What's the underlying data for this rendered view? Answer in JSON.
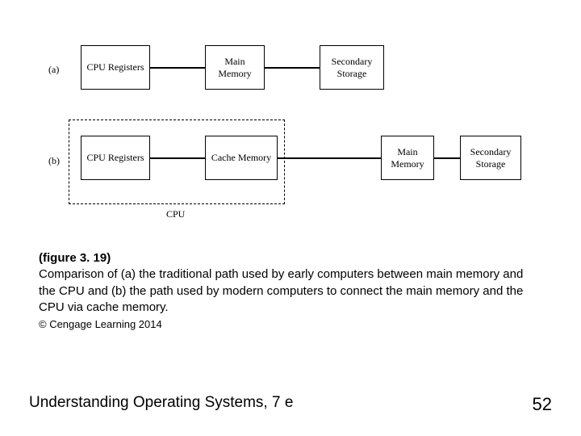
{
  "rows": {
    "a": {
      "label": "(a)"
    },
    "b": {
      "label": "(b)"
    }
  },
  "boxes": {
    "a_cpu_registers": "CPU Registers",
    "a_main_memory": "Main\nMemory",
    "a_secondary_storage": "Secondary\nStorage",
    "b_cpu_registers": "CPU Registers",
    "b_cache_memory": "Cache Memory",
    "b_main_memory": "Main\nMemory",
    "b_secondary_storage": "Secondary\nStorage"
  },
  "cpu_group_label": "CPU",
  "caption": {
    "title": "(figure 3. 19)",
    "body": "Comparison of (a) the traditional path used by early computers between main memory and the CPU and (b) the path used by modern computers to connect the main memory and the CPU via cache memory.",
    "copyright": "© Cengage Learning 2014"
  },
  "footer": {
    "left": "Understanding Operating Systems, 7 e",
    "right": "52"
  }
}
